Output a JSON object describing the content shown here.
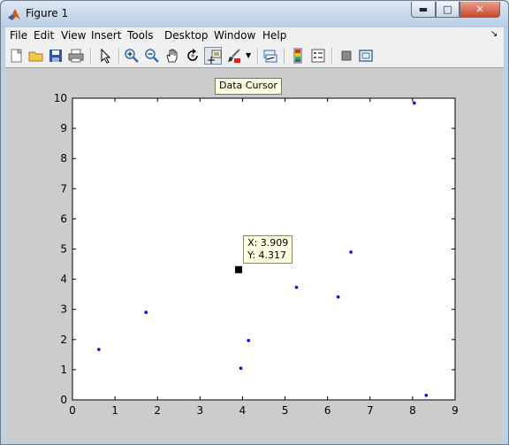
{
  "window": {
    "title": "Figure 1"
  },
  "menu": {
    "items": [
      {
        "label": "File",
        "key": "file"
      },
      {
        "label": "Edit",
        "key": "edit"
      },
      {
        "label": "View",
        "key": "view"
      },
      {
        "label": "Insert",
        "key": "insert"
      },
      {
        "label": "Tools",
        "key": "tools"
      },
      {
        "label": "Desktop",
        "key": "desktop"
      },
      {
        "label": "Window",
        "key": "window"
      },
      {
        "label": "Help",
        "key": "help"
      }
    ]
  },
  "toolbar": {
    "buttons": [
      "new-figure",
      "open-file",
      "save",
      "print",
      "edit-plot",
      "zoom-in",
      "zoom-out",
      "pan",
      "rotate-3d",
      "data-cursor",
      "brush",
      "link-plot",
      "insert-colorbar",
      "insert-legend",
      "hide-plot-tools",
      "show-plot-tools"
    ],
    "active": "data-cursor",
    "tooltip": "Data Cursor"
  },
  "chart_data": {
    "type": "scatter",
    "xlim": [
      0,
      9
    ],
    "ylim": [
      0,
      10
    ],
    "xticks": [
      "0",
      "1",
      "2",
      "3",
      "4",
      "5",
      "6",
      "7",
      "8",
      "9"
    ],
    "yticks": [
      "0",
      "1",
      "2",
      "3",
      "4",
      "5",
      "6",
      "7",
      "8",
      "9",
      "10"
    ],
    "marker_color": "#0000ff",
    "points": [
      {
        "x": 0.62,
        "y": 1.67
      },
      {
        "x": 1.73,
        "y": 2.9
      },
      {
        "x": 3.96,
        "y": 1.05
      },
      {
        "x": 4.14,
        "y": 1.97
      },
      {
        "x": 5.27,
        "y": 3.73
      },
      {
        "x": 6.25,
        "y": 3.41
      },
      {
        "x": 6.55,
        "y": 4.9
      },
      {
        "x": 8.04,
        "y": 9.84
      },
      {
        "x": 8.32,
        "y": 0.15
      }
    ],
    "cursor": {
      "x": 3.909,
      "y": 4.317,
      "label_x": "X: 3.909",
      "label_y": "Y: 4.317"
    }
  }
}
